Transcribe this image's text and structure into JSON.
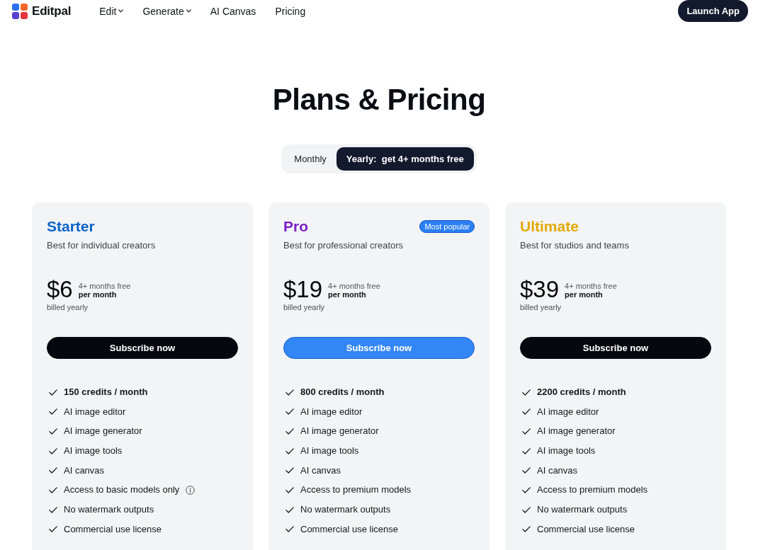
{
  "nav": {
    "brand": "Editpal",
    "links": [
      {
        "label": "Edit",
        "has_menu": true
      },
      {
        "label": "Generate",
        "has_menu": true
      },
      {
        "label": "AI Canvas",
        "has_menu": false
      },
      {
        "label": "Pricing",
        "has_menu": false
      }
    ],
    "cta": "Launch App"
  },
  "title": "Plans & Pricing",
  "billing_toggle": [
    {
      "label": "Monthly",
      "selected": false
    },
    {
      "label": "Yearly:  get 4+ months free",
      "selected": true
    }
  ],
  "plans": [
    {
      "name": "Starter",
      "color": "#0b63c9",
      "tagline": "Best for individual creators",
      "price": "$6",
      "price_note": "4+ months free",
      "period": "per month",
      "billing": "billed yearly",
      "button": {
        "label": "Subscribe now",
        "kind": "dark"
      },
      "features": [
        {
          "text": "150 credits / month",
          "bold": true,
          "has_info": false
        },
        {
          "text": "AI image editor",
          "bold": false,
          "has_info": false
        },
        {
          "text": "AI image generator",
          "bold": false,
          "has_info": false
        },
        {
          "text": "AI image tools",
          "bold": false,
          "has_info": false
        },
        {
          "text": "AI canvas",
          "bold": false,
          "has_info": false
        },
        {
          "text": "Access to basic models only",
          "bold": false,
          "has_info": true
        },
        {
          "text": "No watermark outputs",
          "bold": false,
          "has_info": false
        },
        {
          "text": "Commercial use license",
          "bold": false,
          "has_info": false
        }
      ]
    },
    {
      "name": "Pro",
      "color": "#7a1fc6",
      "tagline": "Best for professional creators",
      "badge": "Most popular",
      "price": "$19",
      "price_note": "4+ months free",
      "period": "per month",
      "billing": "billed yearly",
      "button": {
        "label": "Subscribe now",
        "kind": "accent"
      },
      "features": [
        {
          "text": "800 credits / month",
          "bold": true,
          "has_info": false
        },
        {
          "text": "AI image editor",
          "bold": false,
          "has_info": false
        },
        {
          "text": "AI image generator",
          "bold": false,
          "has_info": false
        },
        {
          "text": "AI image tools",
          "bold": false,
          "has_info": false
        },
        {
          "text": "AI canvas",
          "bold": false,
          "has_info": false
        },
        {
          "text": "Access to premium models",
          "bold": false,
          "has_info": false
        },
        {
          "text": "No watermark outputs",
          "bold": false,
          "has_info": false
        },
        {
          "text": "Commercial use license",
          "bold": false,
          "has_info": false
        }
      ]
    },
    {
      "name": "Ultimate",
      "color": "#e2a900",
      "tagline": "Best for studios and teams",
      "price": "$39",
      "price_note": "4+ months free",
      "period": "per month",
      "billing": "billed yearly",
      "button": {
        "label": "Subscribe now",
        "kind": "dark"
      },
      "features": [
        {
          "text": "2200 credits / month",
          "bold": true,
          "has_info": false
        },
        {
          "text": "AI image editor",
          "bold": false,
          "has_info": false
        },
        {
          "text": "AI image generator",
          "bold": false,
          "has_info": false
        },
        {
          "text": "AI image tools",
          "bold": false,
          "has_info": false
        },
        {
          "text": "AI canvas",
          "bold": false,
          "has_info": false
        },
        {
          "text": "Access to premium models",
          "bold": false,
          "has_info": false
        },
        {
          "text": "No watermark outputs",
          "bold": false,
          "has_info": false
        },
        {
          "text": "Commercial use license",
          "bold": false,
          "has_info": false
        }
      ]
    }
  ]
}
